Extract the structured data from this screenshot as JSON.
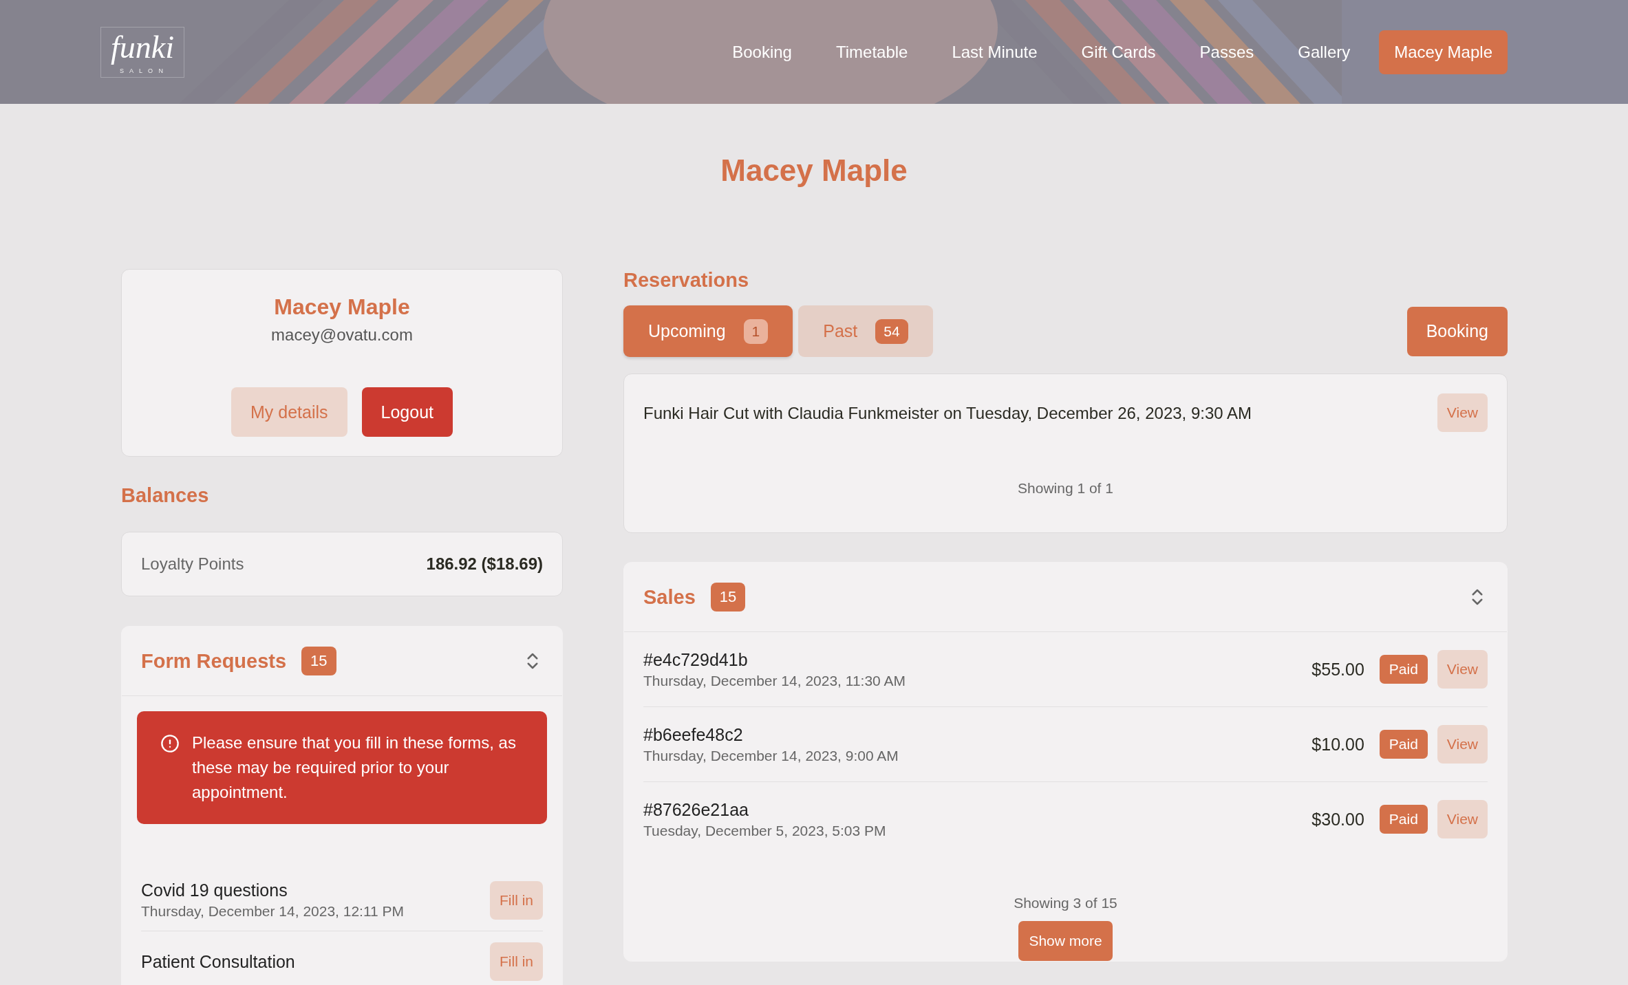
{
  "header": {
    "logo": {
      "name": "funki",
      "tagline": "S A L O N"
    },
    "nav": [
      {
        "label": "Booking",
        "selected": false
      },
      {
        "label": "Timetable",
        "selected": false
      },
      {
        "label": "Last Minute",
        "selected": false
      },
      {
        "label": "Gift Cards",
        "selected": false
      },
      {
        "label": "Passes",
        "selected": false
      },
      {
        "label": "Gallery",
        "selected": false
      },
      {
        "label": "Macey Maple",
        "selected": true
      }
    ]
  },
  "page_title": "Macey Maple",
  "profile": {
    "name": "Macey Maple",
    "email": "macey@ovatu.com",
    "buttons": [
      {
        "label": "My details",
        "kind": "secondary"
      },
      {
        "label": "Logout",
        "kind": "danger"
      }
    ]
  },
  "balances": {
    "heading": "Balances",
    "items": [
      {
        "label": "Loyalty Points",
        "value": "186.92 ($18.69)"
      }
    ]
  },
  "form_requests": {
    "title": "Form Requests",
    "count": "15",
    "alert": "Please ensure that you fill in these forms, as these may be required prior to your appointment.",
    "items": [
      {
        "title": "Covid 19 questions",
        "date": "Thursday, December 14, 2023, 12:11 PM",
        "action": "Fill in"
      },
      {
        "title": "Patient Consultation",
        "action": "Fill in"
      }
    ]
  },
  "reservations": {
    "heading": "Reservations",
    "tabs": [
      {
        "label": "Upcoming",
        "count": "1",
        "selected": true
      },
      {
        "label": "Past",
        "count": "54",
        "selected": false
      }
    ],
    "booking_button": "Booking",
    "items": [
      {
        "text": "Funki Hair Cut with Claudia Funkmeister on Tuesday, December 26, 2023, 9:30 AM",
        "action": "View"
      }
    ],
    "footer": "Showing 1 of 1"
  },
  "sales": {
    "title": "Sales",
    "count": "15",
    "items": [
      {
        "id": "#e4c729d41b",
        "date": "Thursday, December 14, 2023, 11:30 AM",
        "amount": "$55.00",
        "status": "Paid",
        "action": "View"
      },
      {
        "id": "#b6eefe48c2",
        "date": "Thursday, December 14, 2023, 9:00 AM",
        "amount": "$10.00",
        "status": "Paid",
        "action": "View"
      },
      {
        "id": "#87626e21aa",
        "date": "Tuesday, December 5, 2023, 5:03 PM",
        "amount": "$30.00",
        "status": "Paid",
        "action": "View"
      }
    ],
    "footer": "Showing 3 of 15",
    "show_more": "Show more"
  }
}
